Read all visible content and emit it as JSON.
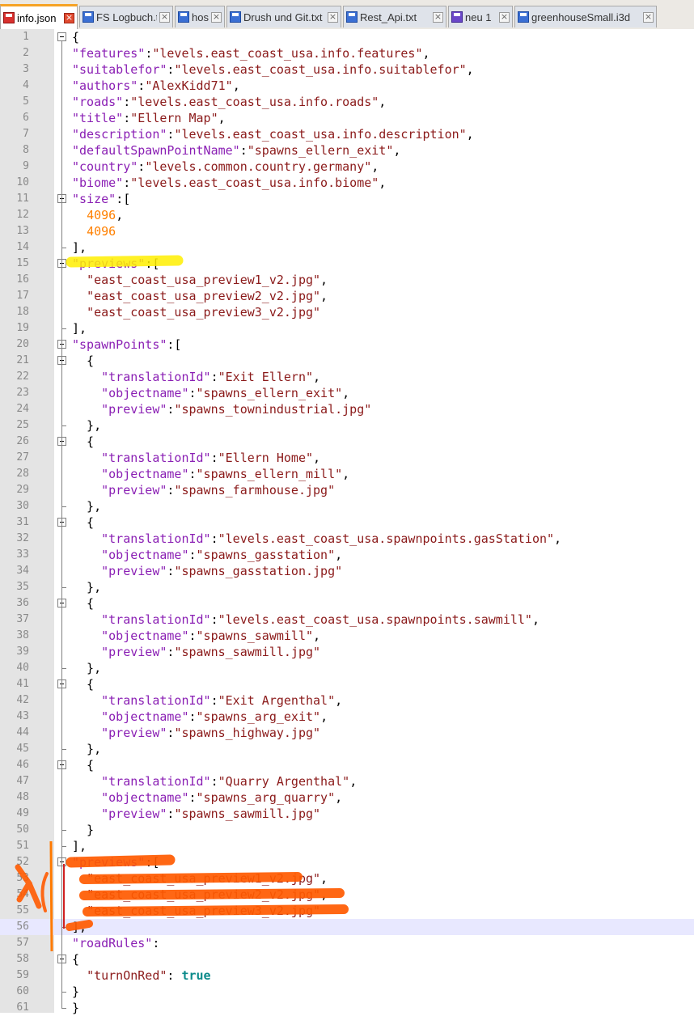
{
  "tabs": [
    {
      "label": "info.json",
      "icon": "unsaved-file-icon",
      "active": true
    },
    {
      "label": "FS Logbuch.txt",
      "icon": "saved-file-icon",
      "active": false
    },
    {
      "label": "hosts",
      "icon": "saved-file-icon",
      "active": false
    },
    {
      "label": "Drush und Git.txt",
      "icon": "saved-file-icon",
      "active": false
    },
    {
      "label": "Rest_Api.txt",
      "icon": "saved-file-icon",
      "active": false
    },
    {
      "label": "neu 1",
      "icon": "saved-file-icon",
      "active": false
    },
    {
      "label": "greenhouseSmall.i3d",
      "icon": "saved-file-icon",
      "active": false
    }
  ],
  "editor": {
    "current_line": 56,
    "lines": [
      {
        "n": "1",
        "t": [
          [
            "p",
            "{"
          ]
        ]
      },
      {
        "n": "2",
        "t": [
          [
            "k",
            "\"features\""
          ],
          [
            "p",
            ":"
          ],
          [
            "s",
            "\"levels.east_coast_usa.info.features\""
          ],
          [
            "p",
            ","
          ]
        ]
      },
      {
        "n": "3",
        "t": [
          [
            "k",
            "\"suitablefor\""
          ],
          [
            "p",
            ":"
          ],
          [
            "s",
            "\"levels.east_coast_usa.info.suitablefor\""
          ],
          [
            "p",
            ","
          ]
        ]
      },
      {
        "n": "4",
        "t": [
          [
            "k",
            "\"authors\""
          ],
          [
            "p",
            ":"
          ],
          [
            "s",
            "\"AlexKidd71\""
          ],
          [
            "p",
            ","
          ]
        ]
      },
      {
        "n": "5",
        "t": [
          [
            "k",
            "\"roads\""
          ],
          [
            "p",
            ":"
          ],
          [
            "s",
            "\"levels.east_coast_usa.info.roads\""
          ],
          [
            "p",
            ","
          ]
        ]
      },
      {
        "n": "6",
        "t": [
          [
            "k",
            "\"title\""
          ],
          [
            "p",
            ":"
          ],
          [
            "s",
            "\"Ellern Map\""
          ],
          [
            "p",
            ","
          ]
        ]
      },
      {
        "n": "7",
        "t": [
          [
            "k",
            "\"description\""
          ],
          [
            "p",
            ":"
          ],
          [
            "s",
            "\"levels.east_coast_usa.info.description\""
          ],
          [
            "p",
            ","
          ]
        ]
      },
      {
        "n": "8",
        "t": [
          [
            "k",
            "\"defaultSpawnPointName\""
          ],
          [
            "p",
            ":"
          ],
          [
            "s",
            "\"spawns_ellern_exit\""
          ],
          [
            "p",
            ","
          ]
        ]
      },
      {
        "n": "9",
        "t": [
          [
            "k",
            "\"country\""
          ],
          [
            "p",
            ":"
          ],
          [
            "s",
            "\"levels.common.country.germany\""
          ],
          [
            "p",
            ","
          ]
        ]
      },
      {
        "n": "10",
        "t": [
          [
            "k",
            "\"biome\""
          ],
          [
            "p",
            ":"
          ],
          [
            "s",
            "\"levels.east_coast_usa.info.biome\""
          ],
          [
            "p",
            ","
          ]
        ]
      },
      {
        "n": "11",
        "t": [
          [
            "k",
            "\"size\""
          ],
          [
            "p",
            ":["
          ]
        ]
      },
      {
        "n": "12",
        "t": [
          [
            "p",
            "  "
          ],
          [
            "n",
            "4096"
          ],
          [
            "p",
            ","
          ]
        ]
      },
      {
        "n": "13",
        "t": [
          [
            "p",
            "  "
          ],
          [
            "n",
            "4096"
          ]
        ]
      },
      {
        "n": "14",
        "t": [
          [
            "p",
            "],"
          ]
        ]
      },
      {
        "n": "15",
        "t": [
          [
            "k",
            "\"previews\""
          ],
          [
            "p",
            ":["
          ]
        ]
      },
      {
        "n": "16",
        "t": [
          [
            "p",
            "  "
          ],
          [
            "s",
            "\"east_coast_usa_preview1_v2.jpg\""
          ],
          [
            "p",
            ","
          ]
        ]
      },
      {
        "n": "17",
        "t": [
          [
            "p",
            "  "
          ],
          [
            "s",
            "\"east_coast_usa_preview2_v2.jpg\""
          ],
          [
            "p",
            ","
          ]
        ]
      },
      {
        "n": "18",
        "t": [
          [
            "p",
            "  "
          ],
          [
            "s",
            "\"east_coast_usa_preview3_v2.jpg\""
          ]
        ]
      },
      {
        "n": "19",
        "t": [
          [
            "p",
            "],"
          ]
        ]
      },
      {
        "n": "20",
        "t": [
          [
            "k",
            "\"spawnPoints\""
          ],
          [
            "p",
            ":["
          ]
        ]
      },
      {
        "n": "21",
        "t": [
          [
            "p",
            "  {"
          ]
        ]
      },
      {
        "n": "22",
        "t": [
          [
            "p",
            "    "
          ],
          [
            "k",
            "\"translationId\""
          ],
          [
            "p",
            ":"
          ],
          [
            "s",
            "\"Exit Ellern\""
          ],
          [
            "p",
            ","
          ]
        ]
      },
      {
        "n": "23",
        "t": [
          [
            "p",
            "    "
          ],
          [
            "k",
            "\"objectname\""
          ],
          [
            "p",
            ":"
          ],
          [
            "s",
            "\"spawns_ellern_exit\""
          ],
          [
            "p",
            ","
          ]
        ]
      },
      {
        "n": "24",
        "t": [
          [
            "p",
            "    "
          ],
          [
            "k",
            "\"preview\""
          ],
          [
            "p",
            ":"
          ],
          [
            "s",
            "\"spawns_townindustrial.jpg\""
          ]
        ]
      },
      {
        "n": "25",
        "t": [
          [
            "p",
            "  },"
          ]
        ]
      },
      {
        "n": "26",
        "t": [
          [
            "p",
            "  {"
          ]
        ]
      },
      {
        "n": "27",
        "t": [
          [
            "p",
            "    "
          ],
          [
            "k",
            "\"translationId\""
          ],
          [
            "p",
            ":"
          ],
          [
            "s",
            "\"Ellern Home\""
          ],
          [
            "p",
            ","
          ]
        ]
      },
      {
        "n": "28",
        "t": [
          [
            "p",
            "    "
          ],
          [
            "k",
            "\"objectname\""
          ],
          [
            "p",
            ":"
          ],
          [
            "s",
            "\"spawns_ellern_mill\""
          ],
          [
            "p",
            ","
          ]
        ]
      },
      {
        "n": "29",
        "t": [
          [
            "p",
            "    "
          ],
          [
            "k",
            "\"preview\""
          ],
          [
            "p",
            ":"
          ],
          [
            "s",
            "\"spawns_farmhouse.jpg\""
          ]
        ]
      },
      {
        "n": "30",
        "t": [
          [
            "p",
            "  },"
          ]
        ]
      },
      {
        "n": "31",
        "t": [
          [
            "p",
            "  {"
          ]
        ]
      },
      {
        "n": "32",
        "t": [
          [
            "p",
            "    "
          ],
          [
            "k",
            "\"translationId\""
          ],
          [
            "p",
            ":"
          ],
          [
            "s",
            "\"levels.east_coast_usa.spawnpoints.gasStation\""
          ],
          [
            "p",
            ","
          ]
        ]
      },
      {
        "n": "33",
        "t": [
          [
            "p",
            "    "
          ],
          [
            "k",
            "\"objectname\""
          ],
          [
            "p",
            ":"
          ],
          [
            "s",
            "\"spawns_gasstation\""
          ],
          [
            "p",
            ","
          ]
        ]
      },
      {
        "n": "34",
        "t": [
          [
            "p",
            "    "
          ],
          [
            "k",
            "\"preview\""
          ],
          [
            "p",
            ":"
          ],
          [
            "s",
            "\"spawns_gasstation.jpg\""
          ]
        ]
      },
      {
        "n": "35",
        "t": [
          [
            "p",
            "  },"
          ]
        ]
      },
      {
        "n": "36",
        "t": [
          [
            "p",
            "  {"
          ]
        ]
      },
      {
        "n": "37",
        "t": [
          [
            "p",
            "    "
          ],
          [
            "k",
            "\"translationId\""
          ],
          [
            "p",
            ":"
          ],
          [
            "s",
            "\"levels.east_coast_usa.spawnpoints.sawmill\""
          ],
          [
            "p",
            ","
          ]
        ]
      },
      {
        "n": "38",
        "t": [
          [
            "p",
            "    "
          ],
          [
            "k",
            "\"objectname\""
          ],
          [
            "p",
            ":"
          ],
          [
            "s",
            "\"spawns_sawmill\""
          ],
          [
            "p",
            ","
          ]
        ]
      },
      {
        "n": "39",
        "t": [
          [
            "p",
            "    "
          ],
          [
            "k",
            "\"preview\""
          ],
          [
            "p",
            ":"
          ],
          [
            "s",
            "\"spawns_sawmill.jpg\""
          ]
        ]
      },
      {
        "n": "40",
        "t": [
          [
            "p",
            "  },"
          ]
        ]
      },
      {
        "n": "41",
        "t": [
          [
            "p",
            "  {"
          ]
        ]
      },
      {
        "n": "42",
        "t": [
          [
            "p",
            "    "
          ],
          [
            "k",
            "\"translationId\""
          ],
          [
            "p",
            ":"
          ],
          [
            "s",
            "\"Exit Argenthal\""
          ],
          [
            "p",
            ","
          ]
        ]
      },
      {
        "n": "43",
        "t": [
          [
            "p",
            "    "
          ],
          [
            "k",
            "\"objectname\""
          ],
          [
            "p",
            ":"
          ],
          [
            "s",
            "\"spawns_arg_exit\""
          ],
          [
            "p",
            ","
          ]
        ]
      },
      {
        "n": "44",
        "t": [
          [
            "p",
            "    "
          ],
          [
            "k",
            "\"preview\""
          ],
          [
            "p",
            ":"
          ],
          [
            "s",
            "\"spawns_highway.jpg\""
          ]
        ]
      },
      {
        "n": "45",
        "t": [
          [
            "p",
            "  },"
          ]
        ]
      },
      {
        "n": "46",
        "t": [
          [
            "p",
            "  {"
          ]
        ]
      },
      {
        "n": "47",
        "t": [
          [
            "p",
            "    "
          ],
          [
            "k",
            "\"translationId\""
          ],
          [
            "p",
            ":"
          ],
          [
            "s",
            "\"Quarry Argenthal\""
          ],
          [
            "p",
            ","
          ]
        ]
      },
      {
        "n": "48",
        "t": [
          [
            "p",
            "    "
          ],
          [
            "k",
            "\"objectname\""
          ],
          [
            "p",
            ":"
          ],
          [
            "s",
            "\"spawns_arg_quarry\""
          ],
          [
            "p",
            ","
          ]
        ]
      },
      {
        "n": "49",
        "t": [
          [
            "p",
            "    "
          ],
          [
            "k",
            "\"preview\""
          ],
          [
            "p",
            ":"
          ],
          [
            "s",
            "\"spawns_sawmill.jpg\""
          ]
        ]
      },
      {
        "n": "50",
        "t": [
          [
            "p",
            "  }"
          ]
        ]
      },
      {
        "n": "51",
        "t": [
          [
            "p",
            "],"
          ]
        ]
      },
      {
        "n": "52",
        "t": [
          [
            "k",
            "\"previews\""
          ],
          [
            "p",
            ":["
          ]
        ]
      },
      {
        "n": "53",
        "t": [
          [
            "p",
            "  "
          ],
          [
            "s",
            "\"east_coast_usa_preview1_v2.jpg\""
          ],
          [
            "p",
            ","
          ]
        ]
      },
      {
        "n": "54",
        "t": [
          [
            "p",
            "  "
          ],
          [
            "s",
            "\"east_coast_usa_preview2_v2.jpg\""
          ],
          [
            "p",
            ","
          ]
        ]
      },
      {
        "n": "55",
        "t": [
          [
            "p",
            "  "
          ],
          [
            "s",
            "\"east_coast_usa_preview3_v2.jpg\""
          ]
        ]
      },
      {
        "n": "56",
        "t": [
          [
            "p",
            "],"
          ]
        ]
      },
      {
        "n": "57",
        "t": [
          [
            "k",
            "\"roadRules\""
          ],
          [
            "p",
            ":"
          ]
        ]
      },
      {
        "n": "58",
        "t": [
          [
            "p",
            "{"
          ]
        ]
      },
      {
        "n": "59",
        "t": [
          [
            "p",
            "  "
          ],
          [
            "s",
            "\"turnOnRed\""
          ],
          [
            "p",
            ": "
          ],
          [
            "b",
            "true"
          ]
        ]
      },
      {
        "n": "60",
        "t": [
          [
            "p",
            "}"
          ]
        ]
      },
      {
        "n": "61",
        "t": [
          [
            "p",
            "}"
          ]
        ]
      }
    ]
  },
  "colors": {
    "key": "#8a1fb4",
    "string": "#8b1a1a",
    "number": "#ff8000",
    "boolean": "#0b8a8a",
    "highlight_yellow": "#ffee00",
    "annotation_orange": "#ff5a00",
    "active_tab_accent": "#f6a325"
  }
}
